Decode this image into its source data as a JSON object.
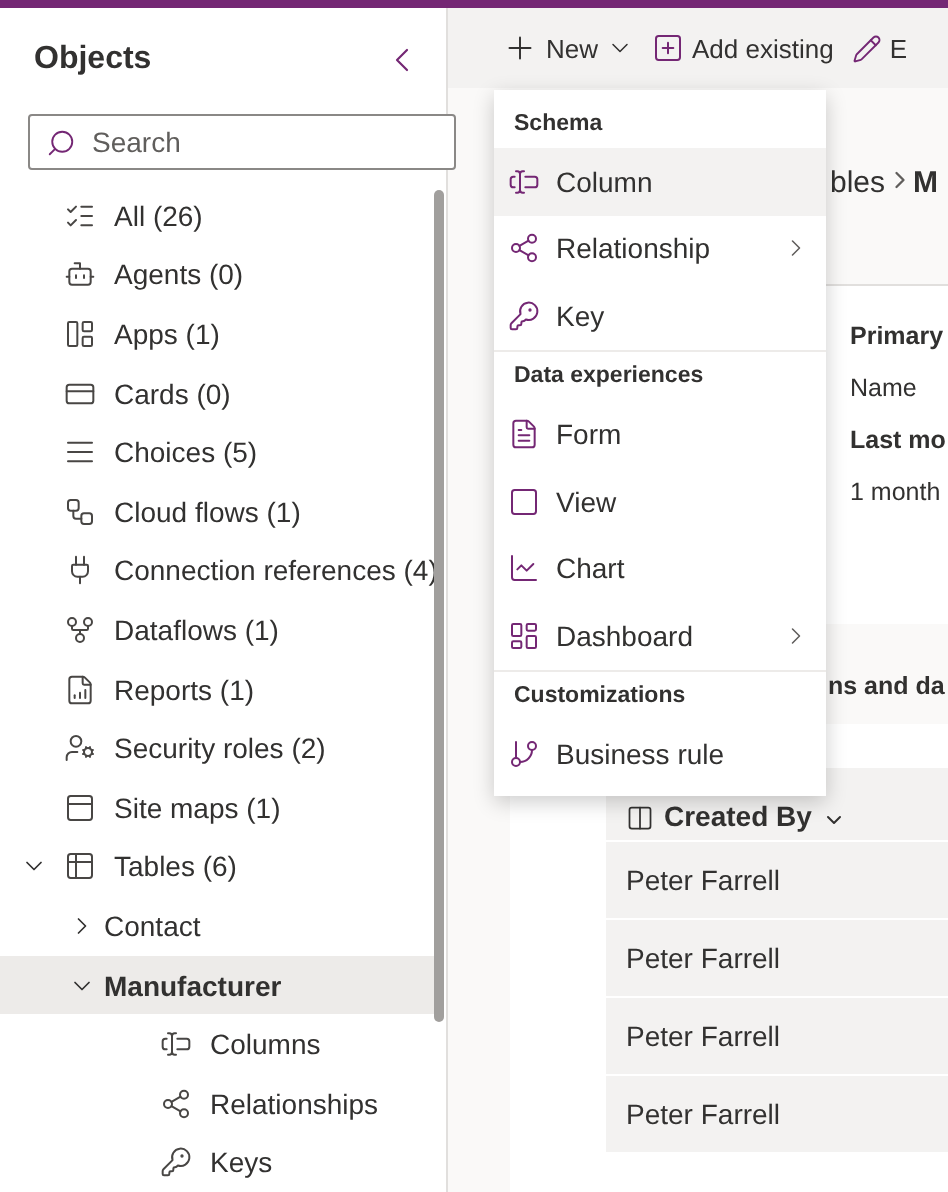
{
  "sidebar": {
    "title": "Objects",
    "search": {
      "placeholder": "Search"
    },
    "items": [
      {
        "kind": "all",
        "label": "All  (26)",
        "selected": false
      },
      {
        "kind": "agents",
        "label": "Agents  (0)",
        "selected": false
      },
      {
        "kind": "apps",
        "label": "Apps  (1)",
        "selected": false
      },
      {
        "kind": "cards",
        "label": "Cards  (0)",
        "selected": false
      },
      {
        "kind": "choices",
        "label": "Choices  (5)",
        "selected": false
      },
      {
        "kind": "flows",
        "label": "Cloud flows  (1)",
        "selected": false
      },
      {
        "kind": "connections",
        "label": "Connection references  (4)",
        "selected": false
      },
      {
        "kind": "dataflows",
        "label": "Dataflows  (1)",
        "selected": false
      },
      {
        "kind": "reports",
        "label": "Reports  (1)",
        "selected": false
      },
      {
        "kind": "roles",
        "label": "Security roles  (2)",
        "selected": false
      },
      {
        "kind": "sitemaps",
        "label": "Site maps  (1)",
        "selected": false
      },
      {
        "kind": "tables",
        "label": "Tables  (6)",
        "selected": false,
        "expanded": true,
        "children": [
          {
            "label": "Contact",
            "selected": false,
            "expanded": false
          },
          {
            "label": "Manufacturer",
            "selected": true,
            "expanded": true,
            "children": [
              {
                "kind": "columns",
                "label": "Columns",
                "selected": false
              },
              {
                "kind": "relationships",
                "label": "Relationships",
                "selected": false
              },
              {
                "kind": "keys",
                "label": "Keys",
                "selected": false
              }
            ]
          }
        ]
      }
    ]
  },
  "toolbar": [
    {
      "kind": "new",
      "label": "New"
    },
    {
      "kind": "add",
      "label": "Add existing"
    },
    {
      "kind": "edit",
      "label": "E"
    }
  ],
  "breadcrumb": {
    "parent": "bles",
    "current": "M"
  },
  "card": [
    {
      "kind": "heading",
      "text": "Primary"
    },
    {
      "kind": "value",
      "text": "Name"
    },
    {
      "kind": "heading",
      "text": "Last mo"
    },
    {
      "kind": "value",
      "text": "1 month"
    }
  ],
  "section_title": "ns and da",
  "table": {
    "columns": [
      "Created By"
    ],
    "rows": [
      [
        "Peter Farrell"
      ],
      [
        "Peter Farrell"
      ],
      [
        "Peter Farrell"
      ],
      [
        "Peter Farrell"
      ]
    ]
  },
  "menu": {
    "groups": [
      {
        "title": "Schema",
        "items": [
          {
            "kind": "column",
            "label": "Column",
            "selected": true,
            "submenu": false
          },
          {
            "kind": "relationship",
            "label": "Relationship",
            "selected": false,
            "submenu": true
          },
          {
            "kind": "key",
            "label": "Key",
            "selected": false,
            "submenu": false
          }
        ]
      },
      {
        "title": "Data experiences",
        "items": [
          {
            "kind": "form",
            "label": "Form",
            "selected": false,
            "submenu": false
          },
          {
            "kind": "view",
            "label": "View",
            "selected": false,
            "submenu": false
          },
          {
            "kind": "chart",
            "label": "Chart",
            "selected": false,
            "submenu": false
          },
          {
            "kind": "dashboard",
            "label": "Dashboard",
            "selected": false,
            "submenu": true
          }
        ]
      },
      {
        "title": "Customizations",
        "items": [
          {
            "kind": "rule",
            "label": "Business rule",
            "selected": false,
            "submenu": false
          }
        ]
      }
    ]
  }
}
